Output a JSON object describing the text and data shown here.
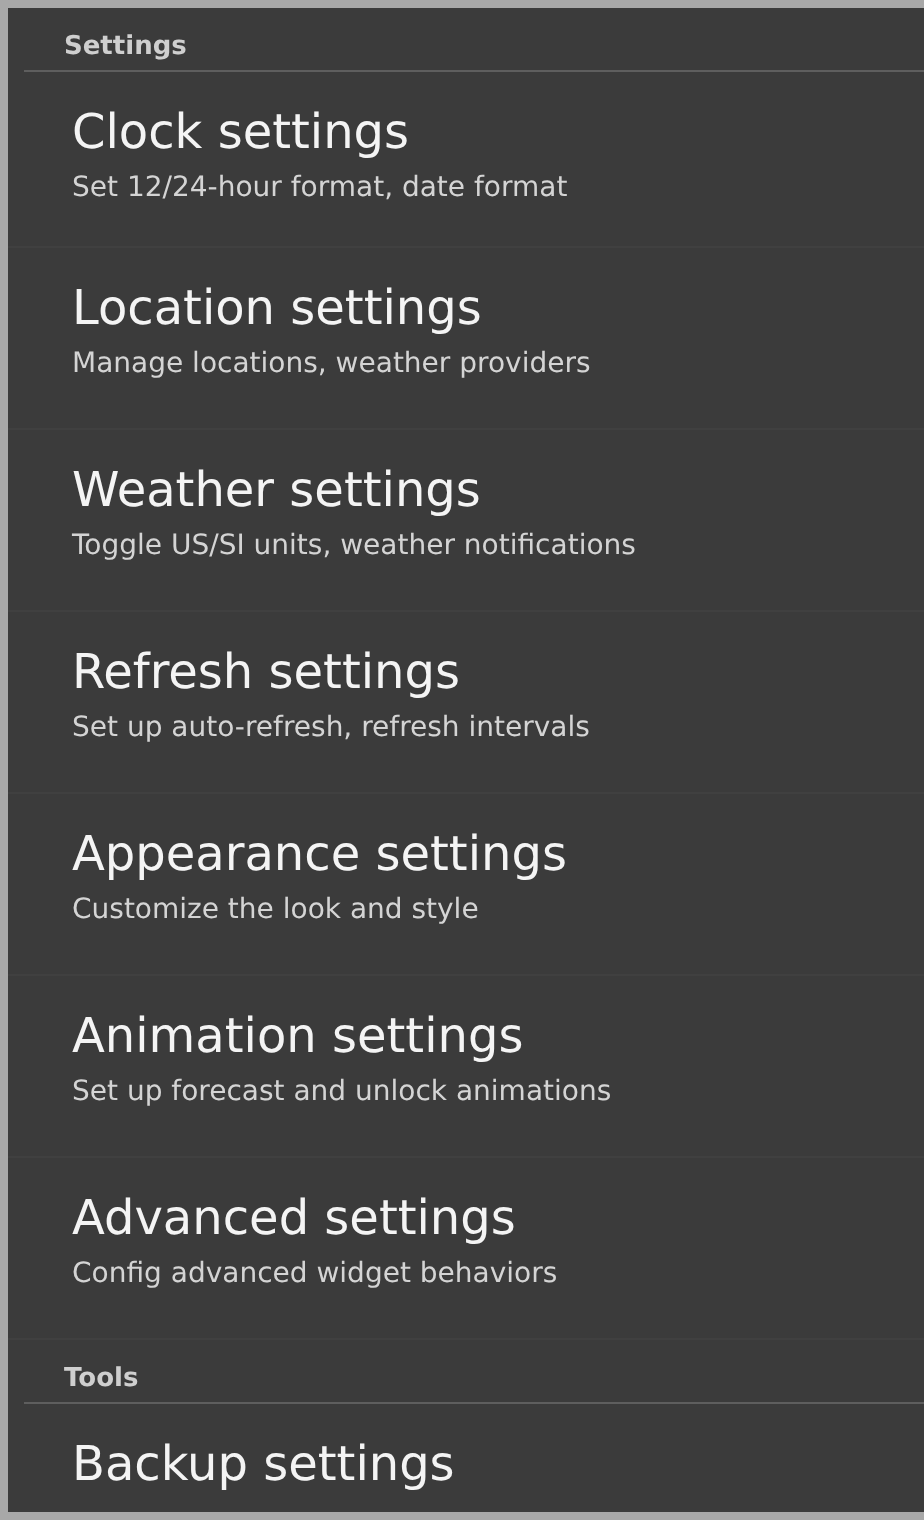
{
  "sections": [
    {
      "header": "Settings",
      "items": [
        {
          "title": "Clock settings",
          "subtitle": "Set 12/24-hour format, date format"
        },
        {
          "title": "Location settings",
          "subtitle": "Manage locations, weather providers"
        },
        {
          "title": "Weather settings",
          "subtitle": "Toggle US/SI units, weather notifications"
        },
        {
          "title": "Refresh settings",
          "subtitle": "Set up auto-refresh, refresh intervals"
        },
        {
          "title": "Appearance settings",
          "subtitle": "Customize the look and style"
        },
        {
          "title": "Animation settings",
          "subtitle": "Set up forecast and unlock animations"
        },
        {
          "title": "Advanced settings",
          "subtitle": "Config advanced widget behaviors"
        }
      ]
    },
    {
      "header": "Tools",
      "items": [
        {
          "title": "Backup settings"
        }
      ]
    }
  ]
}
